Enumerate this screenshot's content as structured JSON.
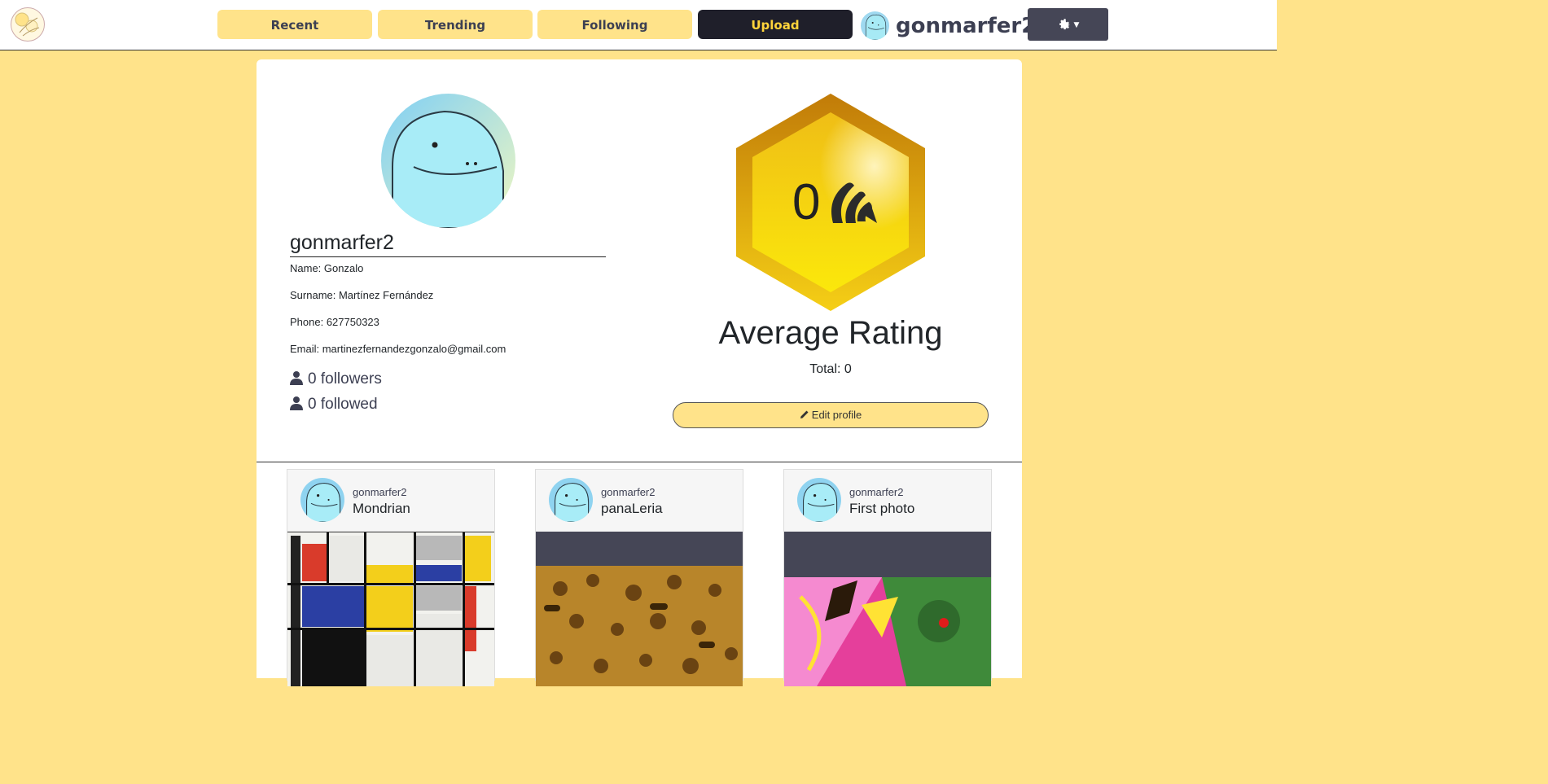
{
  "nav": {
    "tabs": [
      "Recent",
      "Trending",
      "Following"
    ],
    "upload_label": "Upload",
    "username": "gonmarfer2",
    "settings_icon": "gear-icon"
  },
  "profile": {
    "username": "gonmarfer2",
    "name": "Name: Gonzalo",
    "surname": "Surname: Martínez Fernández",
    "phone": "Phone: 627750323",
    "email": "Email: martinezfernandezgonzalo@gmail.com",
    "followers": "0 followers",
    "followed": "0 followed"
  },
  "rating": {
    "value": "0",
    "title": "Average Rating",
    "total": "Total: 0",
    "edit_label": "Edit profile"
  },
  "posts": [
    {
      "user": "gonmarfer2",
      "title": "Mondrian"
    },
    {
      "user": "gonmarfer2",
      "title": "panaLeria"
    },
    {
      "user": "gonmarfer2",
      "title": "First photo"
    }
  ],
  "colors": {
    "background": "#ffe38a",
    "dark": "#1f1f2a",
    "accent": "#ffd43b",
    "text": "#3c3f52"
  }
}
